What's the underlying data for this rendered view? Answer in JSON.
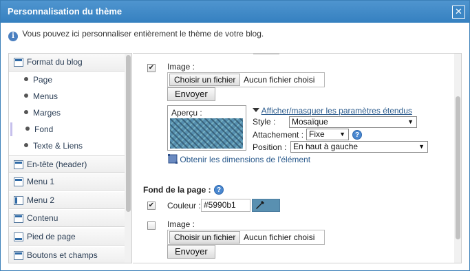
{
  "dialog": {
    "title": "Personnalisation du thème",
    "close_glyph": "✕",
    "info_glyph": "i",
    "info_text": "Vous pouvez ici personnaliser entièrement le thème de votre blog."
  },
  "sidebar": {
    "groups": [
      {
        "label": "Format du blog",
        "icon": "layout-icon"
      },
      {
        "label": "En-tête (header)",
        "icon": "header-icon"
      },
      {
        "label": "Menu 1",
        "icon": "menu-icon"
      },
      {
        "label": "Menu 2",
        "icon": "menu-icon"
      },
      {
        "label": "Contenu",
        "icon": "content-icon"
      },
      {
        "label": "Pied de page",
        "icon": "footer-icon"
      },
      {
        "label": "Boutons et champs",
        "icon": "buttons-icon"
      }
    ],
    "sub_items": [
      {
        "label": "Page"
      },
      {
        "label": "Menus"
      },
      {
        "label": "Marges"
      },
      {
        "label": "Fond",
        "active": true
      },
      {
        "label": "Texte & Liens"
      }
    ]
  },
  "content": {
    "checkmark": "✔",
    "image_section": {
      "checked": true,
      "label": "Image :",
      "choose_button": "Choisir un fichier",
      "file_status": "Aucun fichier choisi",
      "send_button": "Envoyer",
      "preview_label": "Aperçu :",
      "toggle_link": "Afficher/masquer les paramètres étendus",
      "style_label": "Style :",
      "style_value": "Mosaïque",
      "attachment_label": "Attachement :",
      "attachment_value": "Fixe",
      "position_label": "Position :",
      "position_value": "En haut à gauche",
      "dimensions_link": "Obtenir les dimensions de l'élément",
      "help_glyph": "?"
    },
    "page_background": {
      "heading": "Fond de la page :",
      "color_checked": true,
      "color_label": "Couleur :",
      "color_value": "#5990b1",
      "color_swatch": "#5990b1",
      "image_checked": false,
      "image_label": "Image :",
      "choose_button": "Choisir un fichier",
      "file_status": "Aucun fichier choisi",
      "send_button": "Envoyer"
    }
  },
  "colors": {
    "titlebar": "#3580c0",
    "accent": "#2a5a8c"
  }
}
